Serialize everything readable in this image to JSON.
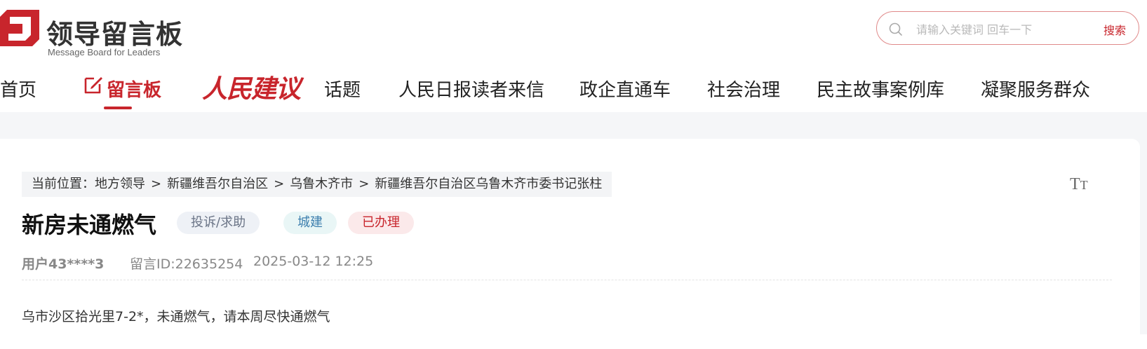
{
  "header": {
    "logo_title": "领导留言板",
    "logo_subtitle": "Message Board for Leaders",
    "brand_color": "#c8252c"
  },
  "search": {
    "placeholder": "请输入关键词 回车一下",
    "value": "",
    "button_label": "搜索",
    "icon": "search-icon"
  },
  "nav": {
    "items": [
      {
        "label": "首页"
      },
      {
        "label": "留言板",
        "active": true,
        "icon": "edit-icon"
      },
      {
        "label": "人民建议"
      },
      {
        "label": "话题"
      },
      {
        "label": "人民日报读者来信"
      },
      {
        "label": "政企直通车"
      },
      {
        "label": "社会治理"
      },
      {
        "label": "民主故事案例库"
      },
      {
        "label": "凝聚服务群众"
      }
    ]
  },
  "breadcrumb": {
    "prefix": "当前位置：",
    "separator": ">",
    "items": [
      "地方领导",
      "新疆维吾尔自治区",
      "乌鲁木齐市",
      "新疆维吾尔自治区乌鲁木齐市委书记张柱"
    ]
  },
  "font_size_control": {
    "label_big": "T",
    "label_small": "T",
    "icon": "font-size-icon"
  },
  "message": {
    "title": "新房未通燃气",
    "tags": {
      "type": "投诉/求助",
      "category": "城建",
      "status": "已办理"
    },
    "user": "用户43****3",
    "id_text": "留言ID:22635254",
    "date": "2025-03-12 12:25",
    "content": "乌市沙区拾光里7-2*，未通燃气，请本周尽快通燃气"
  }
}
